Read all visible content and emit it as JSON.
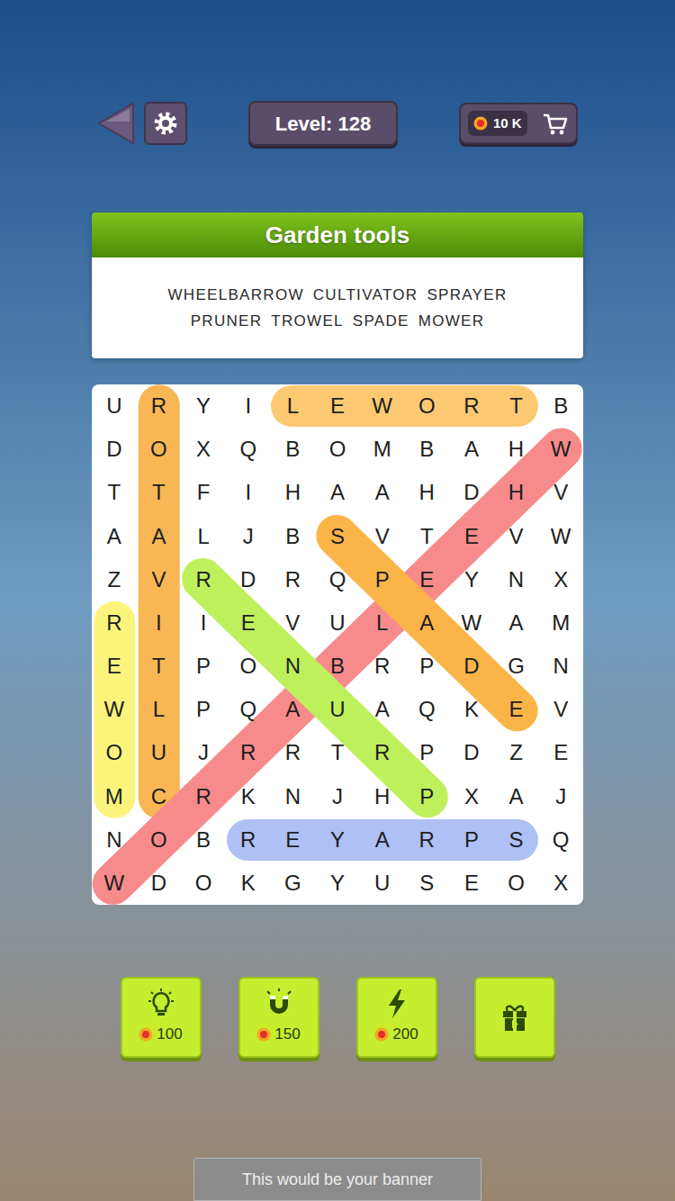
{
  "level": "Level: 128",
  "coins": "10 K",
  "puzzle": {
    "title": "Garden tools",
    "word_lines": [
      [
        "WHEELBARROW",
        "CULTIVATOR",
        "SPRAYER"
      ],
      [
        "PRUNER",
        "TROWEL",
        "SPADE",
        "MOWER"
      ]
    ],
    "grid": [
      [
        "U",
        "R",
        "Y",
        "I",
        "L",
        "E",
        "W",
        "O",
        "R",
        "T",
        "B"
      ],
      [
        "D",
        "O",
        "X",
        "Q",
        "B",
        "O",
        "M",
        "B",
        "A",
        "H",
        "W"
      ],
      [
        "T",
        "T",
        "F",
        "I",
        "H",
        "A",
        "A",
        "H",
        "D",
        "H",
        "V"
      ],
      [
        "A",
        "A",
        "L",
        "J",
        "B",
        "S",
        "V",
        "T",
        "E",
        "V",
        "W"
      ],
      [
        "Z",
        "V",
        "R",
        "D",
        "R",
        "Q",
        "P",
        "E",
        "Y",
        "N",
        "X"
      ],
      [
        "R",
        "I",
        "I",
        "E",
        "V",
        "U",
        "L",
        "A",
        "W",
        "A",
        "M"
      ],
      [
        "E",
        "T",
        "P",
        "O",
        "N",
        "B",
        "R",
        "P",
        "D",
        "G",
        "N"
      ],
      [
        "W",
        "L",
        "P",
        "Q",
        "A",
        "U",
        "A",
        "Q",
        "K",
        "E",
        "V"
      ],
      [
        "O",
        "U",
        "J",
        "R",
        "R",
        "T",
        "R",
        "P",
        "D",
        "Z",
        "E"
      ],
      [
        "M",
        "C",
        "R",
        "K",
        "N",
        "J",
        "H",
        "P",
        "X",
        "A",
        "J"
      ],
      [
        "N",
        "O",
        "B",
        "R",
        "E",
        "Y",
        "A",
        "R",
        "P",
        "S",
        "Q"
      ],
      [
        "W",
        "D",
        "O",
        "K",
        "G",
        "Y",
        "U",
        "S",
        "E",
        "O",
        "X"
      ]
    ],
    "highlights": [
      {
        "start": [
          0,
          4
        ],
        "end": [
          0,
          9
        ],
        "color": "#fcc872"
      },
      {
        "start": [
          0,
          1
        ],
        "end": [
          9,
          1
        ],
        "color": "#f8b654"
      },
      {
        "start": [
          5,
          0
        ],
        "end": [
          9,
          0
        ],
        "color": "#fbf47c"
      },
      {
        "start": [
          1,
          10
        ],
        "end": [
          11,
          0
        ],
        "color": "#f78b8b"
      },
      {
        "start": [
          4,
          2
        ],
        "end": [
          9,
          7
        ],
        "color": "#bef05c"
      },
      {
        "start": [
          3,
          5
        ],
        "end": [
          7,
          9
        ],
        "color": "#fbb447"
      },
      {
        "start": [
          10,
          3
        ],
        "end": [
          10,
          9
        ],
        "color": "#aec0f5"
      }
    ]
  },
  "tools": [
    {
      "kind": "hint",
      "cost": "100"
    },
    {
      "kind": "magnet",
      "cost": "150"
    },
    {
      "kind": "boost",
      "cost": "200"
    },
    {
      "kind": "gift",
      "cost": ""
    }
  ],
  "banner": "This would be your banner"
}
